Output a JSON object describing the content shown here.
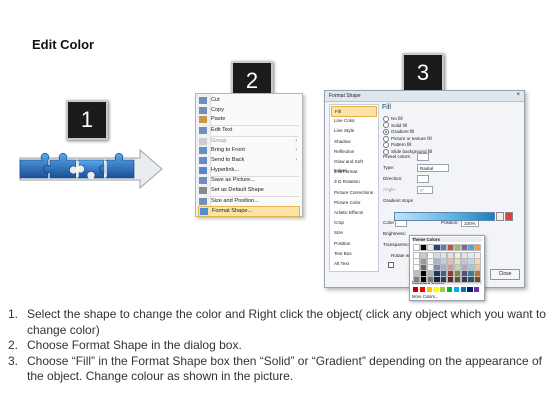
{
  "title": "Edit Color",
  "badges": [
    "1",
    "2",
    "3"
  ],
  "context_menu": {
    "items": [
      {
        "label": "Cut",
        "key": "cut"
      },
      {
        "label": "Copy",
        "key": "copy"
      },
      {
        "label": "Paste",
        "key": "paste"
      },
      {
        "label": "Edit Text",
        "key": "edit-text"
      },
      {
        "label": "Group",
        "key": "group",
        "disabled": true,
        "arrow": "›"
      },
      {
        "label": "Bring to Front",
        "key": "bring-to-front",
        "arrow": "›"
      },
      {
        "label": "Send to Back",
        "key": "send-to-back",
        "arrow": "›"
      },
      {
        "label": "Hyperlink...",
        "key": "hyperlink"
      },
      {
        "label": "Save as Picture...",
        "key": "save-as-picture"
      },
      {
        "label": "Set as Default Shape",
        "key": "set-default-shape"
      },
      {
        "label": "Size and Position...",
        "key": "size-position"
      },
      {
        "label": "Format Shape...",
        "key": "format-shape",
        "highlighted": true
      }
    ]
  },
  "dialog": {
    "title": "Format Shape",
    "close_glyph": "×",
    "categories": [
      "Fill",
      "Line Color",
      "Line Style",
      "Shadow",
      "Reflection",
      "Glow and Soft Edges",
      "3-D Format",
      "3-D Rotation",
      "Picture Corrections",
      "Picture Color",
      "Artistic Effects",
      "Crop",
      "Size",
      "Position",
      "Text Box",
      "Alt Text"
    ],
    "pane_title": "Fill",
    "fill_options": [
      {
        "label": "No fill",
        "checked": false
      },
      {
        "label": "Solid fill",
        "checked": false
      },
      {
        "label": "Gradient fill",
        "checked": true
      },
      {
        "label": "Picture or texture fill",
        "checked": false
      },
      {
        "label": "Pattern fill",
        "checked": false
      },
      {
        "label": "Slide background fill",
        "checked": false
      }
    ],
    "preset_colors_label": "Preset colors:",
    "type_label": "Type:",
    "type_value": "Radial",
    "direction_label": "Direction:",
    "angle_label": "Angle:",
    "angle_value": "0°",
    "gradient_stops_label": "Gradient stops",
    "color_label": "Color",
    "position_label": "Position:",
    "position_value": "100%",
    "brightness_label": "Brightness:",
    "transparency_label": "Transparency:",
    "rotate_label": "Rotate with shape",
    "close_button": "Close"
  },
  "color_popup": {
    "theme_colors_label": "Theme Colors",
    "standard_colors_label": "Standard Colors",
    "more_colors_label": "More Colors...",
    "theme_top": [
      "#ffffff",
      "#000000",
      "#eeece1",
      "#1f497d",
      "#4f81bd",
      "#c0504d",
      "#9bbb59",
      "#8064a2",
      "#4bacc6",
      "#f79646"
    ],
    "standard": [
      "#c00000",
      "#ff0000",
      "#ffc000",
      "#ffff00",
      "#92d050",
      "#00b050",
      "#00b0f0",
      "#0070c0",
      "#002060",
      "#7030a0"
    ]
  },
  "steps": [
    {
      "num": "1.",
      "text": "Select the shape to change the color and Right click the object( click any object which you want to change color)"
    },
    {
      "num": "2.",
      "text": "Choose Format Shape in the dialog box."
    },
    {
      "num": "3.",
      "text": "Choose “Fill” in the Format Shape box then “Solid” or “Gradient” depending on the appearance of the object. Change colour as shown in the picture."
    }
  ],
  "colors": {
    "puzzle_blue": "#2f7fd0",
    "puzzle_dark": "#1a4f96",
    "arrow_fill": "#e6e9ee",
    "highlight": "#fbe3a4"
  }
}
